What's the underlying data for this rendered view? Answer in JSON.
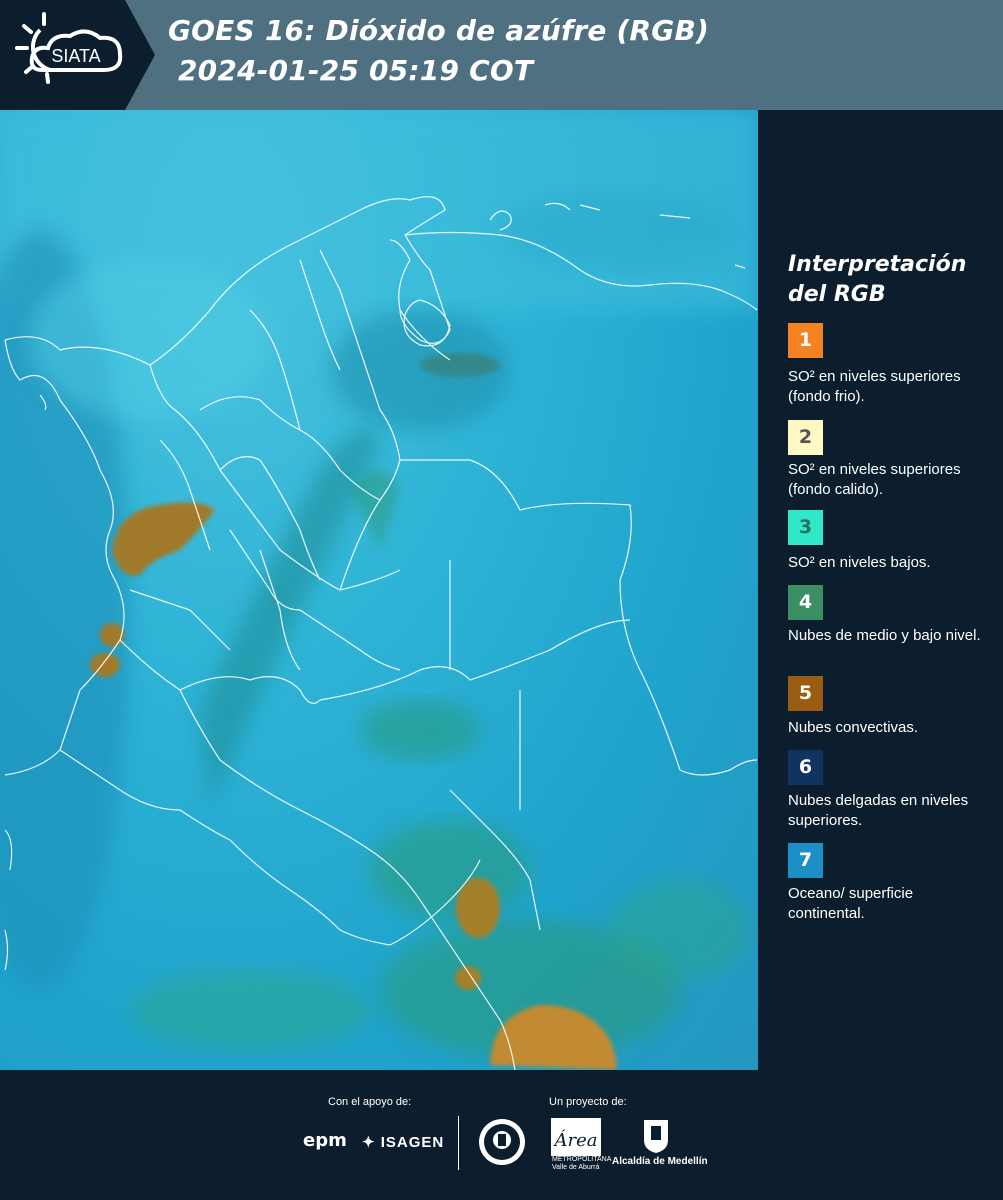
{
  "header": {
    "logo_text": "SIATA",
    "title_line1": "GOES 16: Dióxido de azúfre (RGB)",
    "title_line2": "2024-01-25 05:19 COT",
    "background_color": "#4f7080"
  },
  "legend": {
    "title_line1": "Interpretación",
    "title_line2": "del RGB",
    "items": [
      {
        "number": "1",
        "color": "#f58220",
        "text_color": "#ffffff",
        "label": "SO² en niveles superiores (fondo frio)."
      },
      {
        "number": "2",
        "color": "#fff7c4",
        "text_color": "#555555",
        "label": "SO² en niveles superiores (fondo calido)."
      },
      {
        "number": "3",
        "color": "#2fe8c8",
        "text_color": "#2a6f63",
        "label": "SO² en niveles bajos."
      },
      {
        "number": "4",
        "color": "#3b8f62",
        "text_color": "#ffffff",
        "label": "Nubes de medio y bajo nivel."
      },
      {
        "number": "5",
        "color": "#9a5b12",
        "text_color": "#ffffff",
        "label": "Nubes convectivas."
      },
      {
        "number": "6",
        "color": "#0f3460",
        "text_color": "#ffffff",
        "label": "Nubes delgadas en niveles superiores."
      },
      {
        "number": "7",
        "color": "#1d8fc7",
        "text_color": "#ffffff",
        "label": "Oceano/ superficie continental."
      }
    ]
  },
  "footer": {
    "support_label": "Con el apoyo de:",
    "project_label": "Un proyecto de:",
    "sponsors": [
      "epm",
      "ISAGEN"
    ],
    "partners": [
      "Área Metropolitana Valle de Aburrá",
      "Alcaldía de Medellín"
    ],
    "area_logo_text": "Área",
    "metro_text": "METROPOLITANA Valle de Aburrá",
    "alcaldia_label": "Alcaldía de Medellín"
  },
  "colors": {
    "ocean": "#2fb4d6",
    "border_lines": "#ffffff",
    "convective": "#b58a2a",
    "panel_bg": "#0c1e2d"
  }
}
